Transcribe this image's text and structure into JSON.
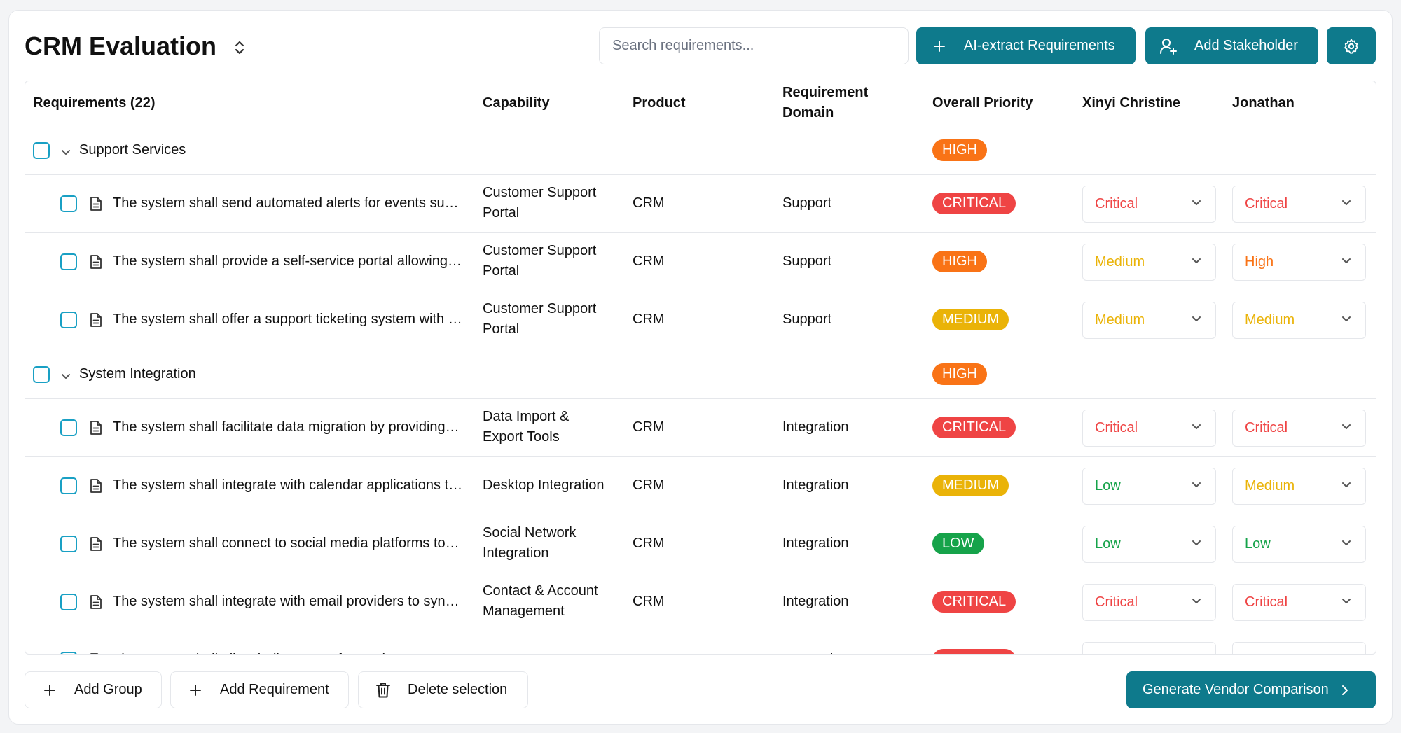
{
  "header": {
    "title": "CRM Evaluation",
    "search_placeholder": "Search requirements...",
    "ai_extract_label": "AI-extract Requirements",
    "add_stakeholder_label": "Add Stakeholder"
  },
  "colors": {
    "primary": "#0e7a8c",
    "critical": "#ef4444",
    "high": "#f97316",
    "medium": "#eab308",
    "low": "#16a34a",
    "checkbox": "#19a0c4"
  },
  "table": {
    "columns": {
      "requirements": "Requirements (22)",
      "capability": "Capability",
      "product": "Product",
      "domain_line1": "Requirement",
      "domain_line2": "Domain",
      "overall_priority": "Overall Priority",
      "stakeholder1": "Xinyi Christine",
      "stakeholder2": "Jonathan"
    },
    "groups": [
      {
        "name": "Support Services",
        "priority": "HIGH",
        "rows": [
          {
            "text": "The system shall send automated alerts for events such as ticket escalations",
            "cap1": "Customer Support",
            "cap2": "Portal",
            "product": "CRM",
            "domain": "Support",
            "priority": "CRITICAL",
            "s1": "Critical",
            "s2": "Critical"
          },
          {
            "text": "The system shall provide a self-service portal allowing customers to find answers",
            "cap1": "Customer Support",
            "cap2": "Portal",
            "product": "CRM",
            "domain": "Support",
            "priority": "HIGH",
            "s1": "Medium",
            "s2": "High"
          },
          {
            "text": "The system shall offer a support ticketing system with tracking",
            "cap1": "Customer Support",
            "cap2": "Portal",
            "product": "CRM",
            "domain": "Support",
            "priority": "MEDIUM",
            "s1": "Medium",
            "s2": "Medium"
          }
        ]
      },
      {
        "name": "System Integration",
        "priority": "HIGH",
        "rows": [
          {
            "text": "The system shall facilitate data migration by providing import tools",
            "cap1": "Data Import &",
            "cap2": "Export Tools",
            "product": "CRM",
            "domain": "Integration",
            "priority": "CRITICAL",
            "s1": "Critical",
            "s2": "Critical"
          },
          {
            "text": "The system shall integrate with calendar applications to sync meetings",
            "cap1": "Desktop Integration",
            "cap2": "",
            "product": "CRM",
            "domain": "Integration",
            "priority": "MEDIUM",
            "s1": "Low",
            "s2": "Medium"
          },
          {
            "text": "The system shall connect to social media platforms to track engagement",
            "cap1": "Social Network",
            "cap2": "Integration",
            "product": "CRM",
            "domain": "Integration",
            "priority": "LOW",
            "s1": "Low",
            "s2": "Low"
          },
          {
            "text": "The system shall integrate with email providers to sync conversations",
            "cap1": "Contact & Account",
            "cap2": "Management",
            "product": "CRM",
            "domain": "Integration",
            "priority": "CRITICAL",
            "s1": "Critical",
            "s2": "Critical"
          },
          {
            "text": "The system shall allow bulk export of records",
            "cap1": "Data Import &",
            "cap2": "",
            "product": "CRM",
            "domain": "Integration",
            "priority": "CRITICAL",
            "s1": "Critical",
            "s2": "Critical"
          }
        ]
      }
    ]
  },
  "footer": {
    "add_group_label": "Add Group",
    "add_requirement_label": "Add Requirement",
    "delete_selection_label": "Delete selection",
    "generate_label": "Generate Vendor Comparison"
  }
}
